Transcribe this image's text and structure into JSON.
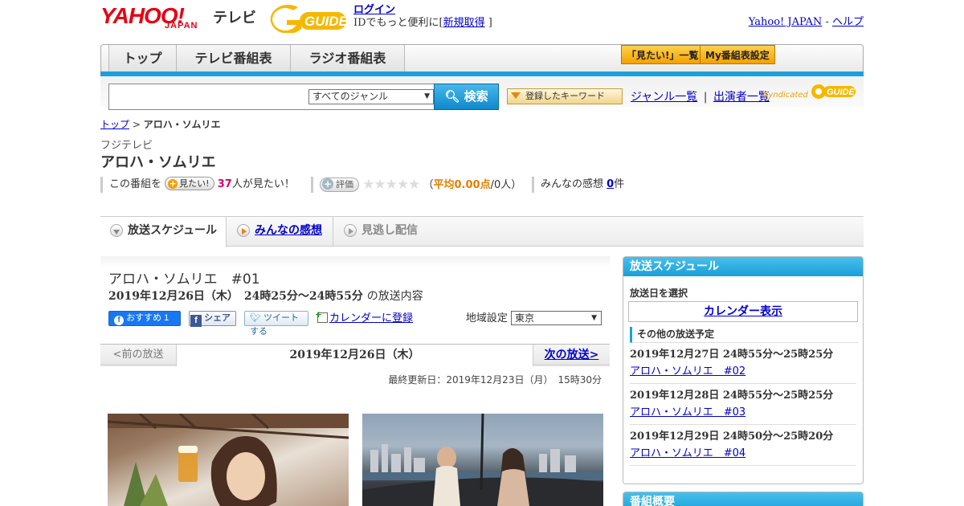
{
  "header": {
    "logo_yahoo": "YAHOO!",
    "logo_japan": "JAPAN",
    "logo_tv": "テレビ",
    "logo_guide": "G GUIDE",
    "login_label": "ログイン",
    "login_note_prefix": "IDでもっと便利に[",
    "register_label": "新規取得",
    "login_note_suffix": "]",
    "yahoo_japan_link": "Yahoo! JAPAN",
    "sep": " - ",
    "help_link": "ヘルプ"
  },
  "nav": {
    "tabs": [
      {
        "label": "トップ"
      },
      {
        "label": "テレビ番組表"
      },
      {
        "label": "ラジオ番組表"
      }
    ],
    "mitai_list": "「見たい!」一覧",
    "my_schedule": "My番組表設定"
  },
  "search": {
    "value": "",
    "genre_selected": "すべてのジャンル",
    "search_button": "検索",
    "keyword_button": "登録したキーワード",
    "genre_list": "ジャンル一覧",
    "divider": "|",
    "cast_list": "出演者一覧",
    "syndicated": "Syndicated"
  },
  "breadcrumb": {
    "home": "トップ",
    "sep": " > ",
    "current": "アロハ・ソムリエ"
  },
  "program": {
    "station": "フジテレビ",
    "title": "アロハ・ソムリエ",
    "want_prefix": "この番組を",
    "want_button": "見たい!",
    "want_count": "37",
    "want_suffix": "人が見たい！",
    "rating_button": "評価",
    "stars": "★★★★★",
    "rating_open": "（",
    "rating_avg_label": "平均0.00点",
    "rating_people": "/0人）",
    "impressions_label": "みんなの感想",
    "impressions_count": "0",
    "impressions_unit": "件"
  },
  "tabs": [
    {
      "label": "放送スケジュール"
    },
    {
      "label": "みんなの感想"
    },
    {
      "label": "見逃し配信"
    }
  ],
  "episode": {
    "title": "アロハ・ソムリエ　#01",
    "date": "2019年12月26日（木）　24時25分～24時55分",
    "date_suffix": "の放送内容",
    "fb_recommend": "おすすめ 1",
    "fb_share": "シェア",
    "tweet": "ツイートする",
    "calendar": "カレンダーに登録",
    "region_label": "地域設定",
    "region_value": "東京"
  },
  "pager": {
    "prev": "<前の放送",
    "current": "2019年12月26日（木）",
    "next": "次の放送>"
  },
  "updated": "最終更新日：2019年12月23日（月）　15時30分",
  "sidebar": {
    "heading": "放送スケジュール",
    "select_date": "放送日を選択",
    "calendar_button": "カレンダー表示",
    "other_heading": "その他の放送予定",
    "others": [
      {
        "date": "2019年12月27日  24時55分～25時25分",
        "title": "アロハ・ソムリエ　#02"
      },
      {
        "date": "2019年12月28日  24時55分～25時25分",
        "title": "アロハ・ソムリエ　#03"
      },
      {
        "date": "2019年12月29日  24時50分～25時20分",
        "title": "アロハ・ソムリエ　#04"
      }
    ],
    "overview_heading": "番組概要"
  },
  "colors": {
    "accent_blue": "#1aa0dc",
    "yahoo_red": "#e60012",
    "guide_yellow": "#f5b800",
    "want_count": "#d9006c",
    "avg_orange": "#e08000"
  }
}
